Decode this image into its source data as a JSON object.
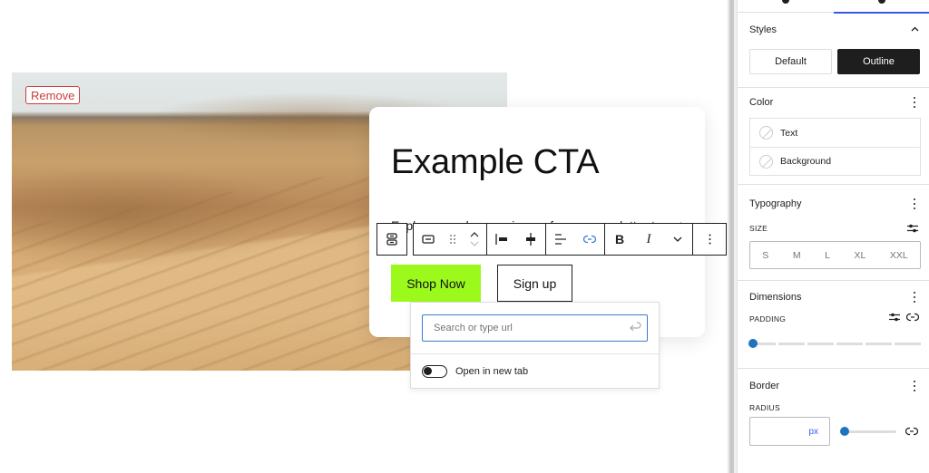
{
  "canvas": {
    "remove_label": "Remove",
    "cta": {
      "title": "Example CTA",
      "description": "Explore our shop or sign up for our newsletter to get exclusive offers",
      "primary_button": "Shop Now",
      "secondary_button": "Sign up",
      "colors": {
        "primary_bg": "#9cf91c",
        "remove": "#cc3d3d"
      }
    },
    "toolbar": {
      "block_type_icon": "buttons-icon",
      "groups": [
        [
          "button-block-icon",
          "drag-handle-icon",
          "move-up-down-icon"
        ],
        [
          "justify-left-icon",
          "justify-center-icon"
        ],
        [
          "align-icon",
          "link-icon"
        ],
        [
          "bold-icon",
          "italic-icon",
          "more-rich-text-icon"
        ],
        [
          "options-icon"
        ]
      ],
      "bold_label": "B",
      "italic_label": "I"
    },
    "link_popover": {
      "placeholder": "Search or type url",
      "toggle_label": "Open in new tab",
      "open_in_new_tab": false
    }
  },
  "sidebar": {
    "tabs": [
      {
        "name": "settings",
        "active": false
      },
      {
        "name": "styles",
        "active": true
      }
    ],
    "styles": {
      "title": "Styles",
      "options": [
        "Default",
        "Outline"
      ],
      "selected": "Outline"
    },
    "color": {
      "title": "Color",
      "items": [
        "Text",
        "Background"
      ]
    },
    "typography": {
      "title": "Typography",
      "size_label": "SIZE",
      "sizes": [
        "S",
        "M",
        "L",
        "XL",
        "XXL"
      ]
    },
    "dimensions": {
      "title": "Dimensions",
      "padding_label": "PADDING",
      "padding_value": 0
    },
    "border": {
      "title": "Border",
      "radius_label": "RADIUS",
      "radius_value": "",
      "radius_unit": "px",
      "radius_slider_value": 0
    },
    "accent_color": "#3858e9"
  }
}
